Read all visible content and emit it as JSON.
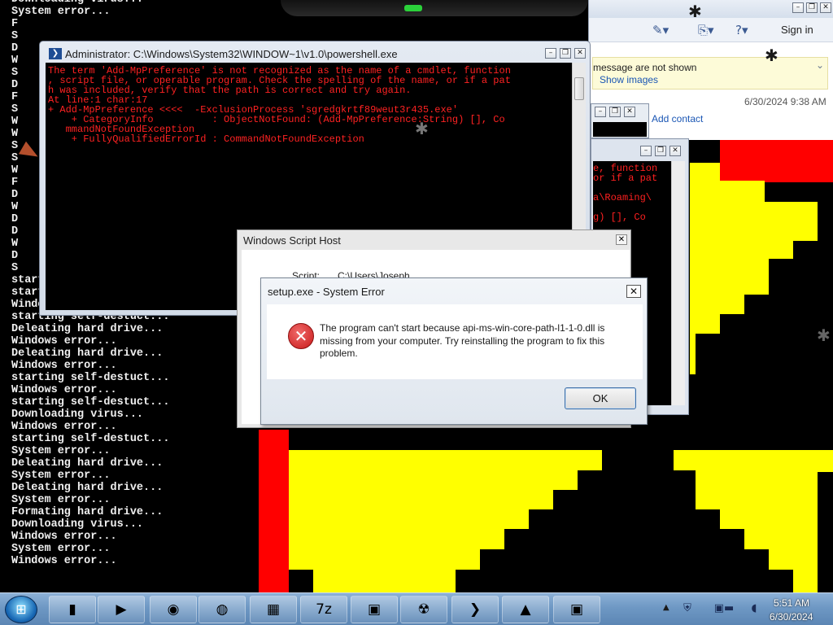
{
  "console": {
    "lines": [
      "Downloading virus...",
      "System error...",
      "F",
      "S",
      "D",
      "W",
      "S",
      "D",
      "F",
      "S",
      "W",
      "W",
      "S",
      "S",
      "W",
      "F",
      "D",
      "W",
      "D",
      "D",
      "W",
      "D",
      "S",
      "starting self-destuct...",
      "starting self-destuct...",
      "Windows error...",
      "starting self-destuct...",
      "Deleating hard drive...",
      "Windows error...",
      "Deleating hard drive...",
      "Windows error...",
      "starting self-destuct...",
      "Windows error...",
      "starting self-destuct...",
      "Downloading virus...",
      "Windows error...",
      "starting self-destuct...",
      "System error...",
      "Deleating hard drive...",
      "System error...",
      "Deleating hard drive...",
      "System error...",
      "Formating hard drive...",
      "Downloading virus...",
      "Windows error...",
      "System error...",
      "Windows error..."
    ]
  },
  "email": {
    "toolbar_icons": [
      "pencil-icon",
      "copy-icon",
      "help-icon"
    ],
    "signin_label": "Sign in",
    "info_text": "message are not shown",
    "show_images_label": "Show images",
    "date": "6/30/2024 9:38 AM",
    "add_contact_label": "Add contact"
  },
  "ps_window": {
    "title": "Administrator: C:\\Windows\\System32\\WINDOW~1\\v1.0\\powershell.exe",
    "lines": [
      "The term 'Add-MpPreference' is not recognized as the name of a cmdlet, function",
      ", script file, or operable program. Check the spelling of the name, or if a pat",
      "h was included, verify that the path is correct and try again.",
      "At line:1 char:17",
      "+ Add-MpPreference <<<<  -ExclusionProcess 'sgredgkrtf89weut3r435.exe'",
      "    + CategoryInfo          : ObjectNotFound: (Add-MpPreference:String) [], Co",
      "   mmandNotFoundException",
      "    + FullyQualifiedErrorId : CommandNotFoundException"
    ]
  },
  "ps2_window": {
    "lines": [
      "e, function",
      "or if a pat",
      "",
      "a\\Roaming\\",
      "",
      "g) [], Co"
    ]
  },
  "wsh_window": {
    "title": "Windows Script Host",
    "script_label": "Script:",
    "script_value": "C:\\Users\\Joseph"
  },
  "error_dialog": {
    "title": "setup.exe - System Error",
    "message": "The program can't start because api-ms-win-core-path-l1-1-0.dll is missing from your computer. Try reinstalling the program to fix this problem.",
    "ok_label": "OK"
  },
  "taskbar": {
    "buttons": [
      {
        "name": "terminal-app",
        "glyph": "▮"
      },
      {
        "name": "media-player-app",
        "glyph": "▶"
      },
      {
        "name": "globe-app",
        "glyph": "◉"
      },
      {
        "name": "firefox-app",
        "glyph": "◍"
      },
      {
        "name": "image-viewer-app",
        "glyph": "▦"
      },
      {
        "name": "7zip-app",
        "glyph": "7z"
      },
      {
        "name": "window-app-1",
        "glyph": "▣"
      },
      {
        "name": "radiation-app",
        "glyph": "☢"
      },
      {
        "name": "powershell-app",
        "glyph": "❯"
      },
      {
        "name": "shapes-app",
        "glyph": "▲"
      },
      {
        "name": "window-app-2",
        "glyph": "▣"
      }
    ],
    "clock_time": "5:51 AM",
    "clock_date": "6/30/2024"
  },
  "colors": {
    "console_text": "#f0f0f0",
    "error_red": "#ff2222",
    "pixel_yellow": "#ffff00",
    "pixel_red": "#ff0000"
  }
}
